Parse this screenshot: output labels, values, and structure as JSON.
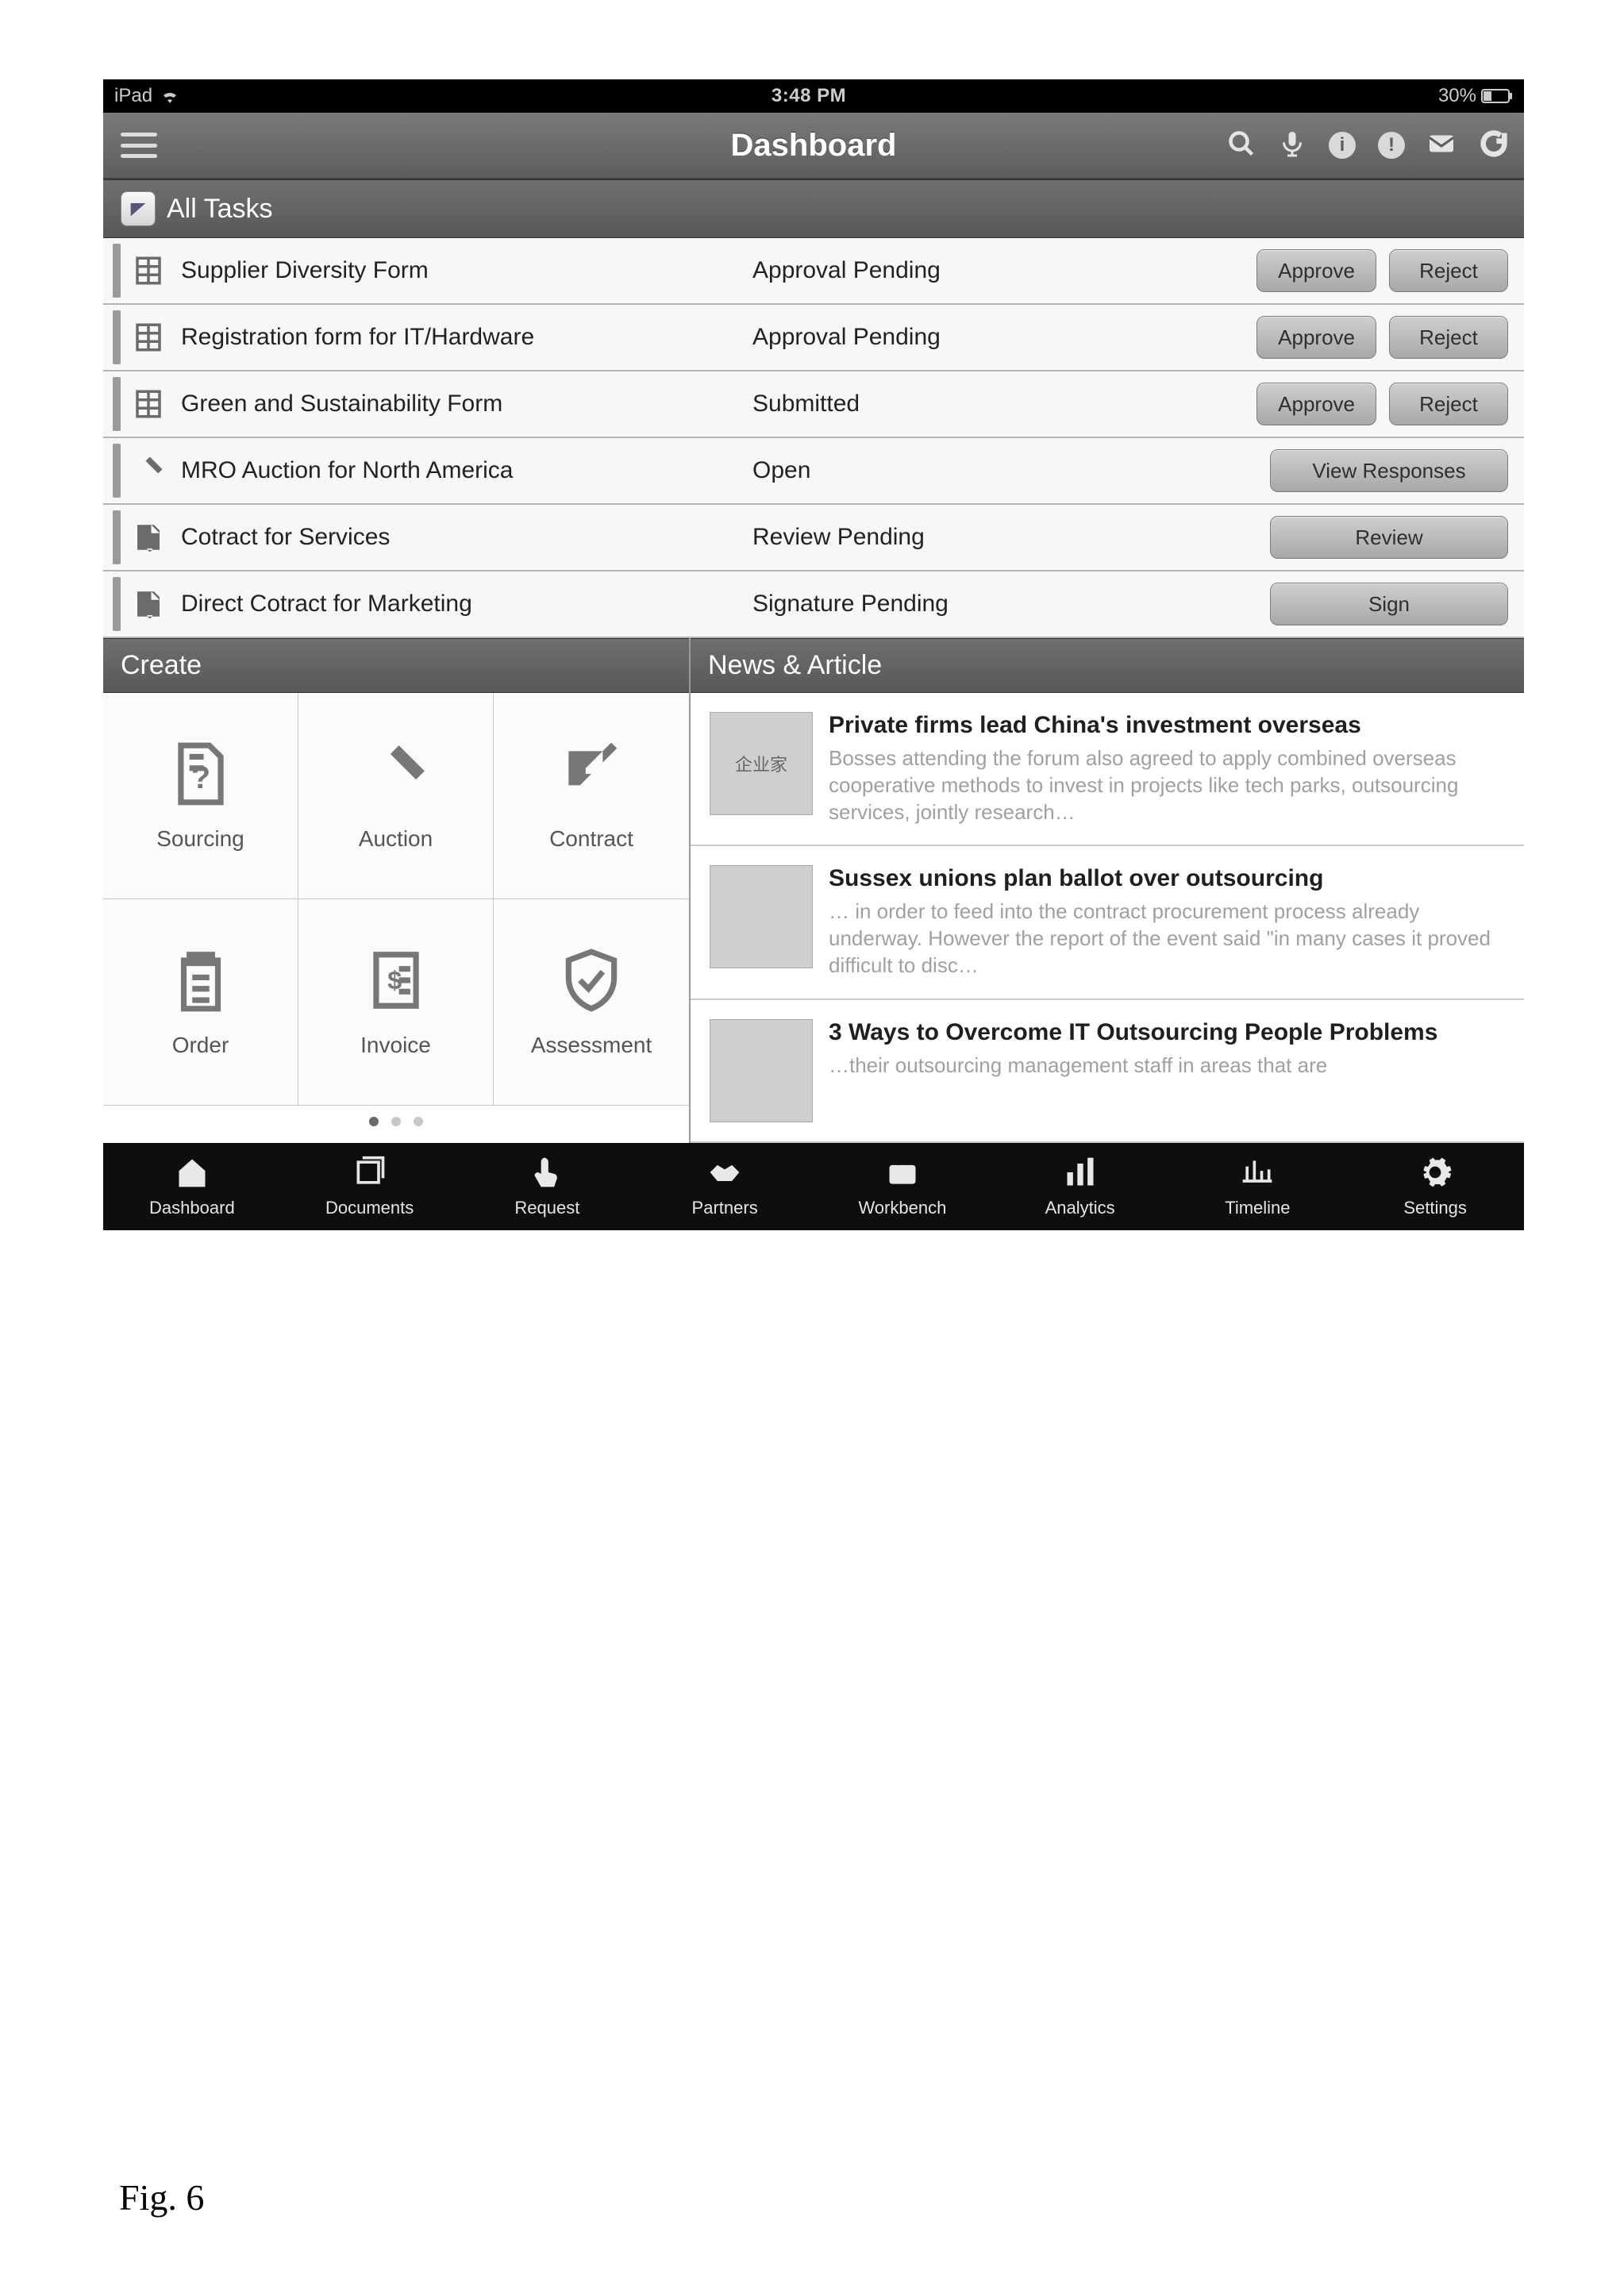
{
  "status_bar": {
    "carrier": "iPad",
    "time": "3:48 PM",
    "battery": "30%"
  },
  "nav": {
    "title": "Dashboard"
  },
  "sections": {
    "tasks_header": "All Tasks",
    "create_header": "Create",
    "news_header": "News & Article"
  },
  "tasks": [
    {
      "icon": "form",
      "title": "Supplier Diversity Form",
      "status": "Approval Pending",
      "actions": [
        "Approve",
        "Reject"
      ]
    },
    {
      "icon": "form",
      "title": "Registration form for IT/Hardware",
      "status": "Approval Pending",
      "actions": [
        "Approve",
        "Reject"
      ]
    },
    {
      "icon": "form",
      "title": "Green and Sustainability Form",
      "status": "Submitted",
      "actions": [
        "Approve",
        "Reject"
      ]
    },
    {
      "icon": "gavel",
      "title": "MRO Auction for North America",
      "status": "Open",
      "actions": [
        "View Responses"
      ]
    },
    {
      "icon": "contract",
      "title": "Cotract for Services",
      "status": "Review Pending",
      "actions": [
        "Review"
      ]
    },
    {
      "icon": "contract",
      "title": "Direct Cotract for Marketing",
      "status": "Signature Pending",
      "actions": [
        "Sign"
      ]
    }
  ],
  "create_tiles": [
    {
      "label": "Sourcing",
      "icon": "doc-question"
    },
    {
      "label": "Auction",
      "icon": "gavel"
    },
    {
      "label": "Contract",
      "icon": "pen-paper"
    },
    {
      "label": "Order",
      "icon": "clipboard"
    },
    {
      "label": "Invoice",
      "icon": "invoice"
    },
    {
      "label": "Assessment",
      "icon": "shield-check"
    }
  ],
  "news": [
    {
      "title": "Private firms lead China's investment overseas",
      "summary": "Bosses attending the forum also agreed to apply combined overseas cooperative methods to invest in projects like tech parks, outsourcing services, jointly research…",
      "thumb_text": "企业家"
    },
    {
      "title": "Sussex unions plan ballot over outsourcing",
      "summary": "… in order to feed into the contract procurement process already underway. However the report of the event said \"in many cases it proved difficult to disc…",
      "thumb_text": ""
    },
    {
      "title": "3 Ways to Overcome IT Outsourcing People Problems",
      "summary": "…their outsourcing management staff in areas that are",
      "thumb_text": ""
    }
  ],
  "tabs": [
    {
      "label": "Dashboard",
      "icon": "home"
    },
    {
      "label": "Documents",
      "icon": "stack"
    },
    {
      "label": "Request",
      "icon": "touch"
    },
    {
      "label": "Partners",
      "icon": "handshake"
    },
    {
      "label": "Workbench",
      "icon": "briefcase"
    },
    {
      "label": "Analytics",
      "icon": "bars"
    },
    {
      "label": "Timeline",
      "icon": "timeline"
    },
    {
      "label": "Settings",
      "icon": "gear"
    }
  ],
  "figure_label": "Fig. 6"
}
